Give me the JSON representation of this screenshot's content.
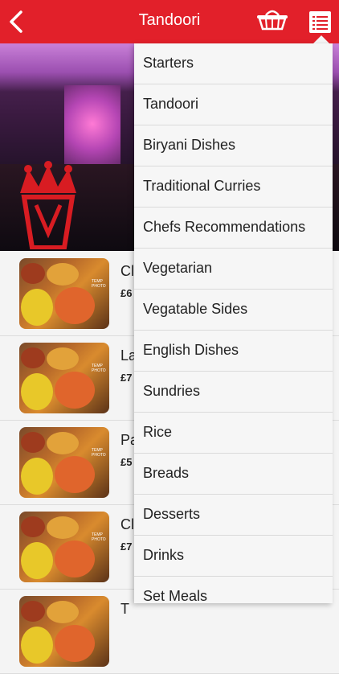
{
  "header": {
    "title": "Tandoori",
    "back_icon": "chevron-left-icon",
    "basket_icon": "basket-icon",
    "menu_icon": "list-menu-icon"
  },
  "colors": {
    "accent": "#e2202a"
  },
  "list": {
    "items": [
      {
        "name": "Cl",
        "price": "£6",
        "thumb_tag": "TEMP PHOTO"
      },
      {
        "name": "La",
        "price": "£7",
        "thumb_tag": "TEMP PHOTO"
      },
      {
        "name": "Pa",
        "price": "£5",
        "thumb_tag": "TEMP PHOTO"
      },
      {
        "name": "Cl",
        "price": "£7",
        "thumb_tag": "TEMP PHOTO"
      },
      {
        "name": "T",
        "price": "",
        "thumb_tag": ""
      }
    ]
  },
  "dropdown": {
    "items": [
      "Starters",
      "Tandoori",
      "Biryani Dishes",
      "Traditional Curries",
      "Chefs Recommendations",
      "Vegetarian",
      "Vegatable Sides",
      "English Dishes",
      "Sundries",
      "Rice",
      "Breads",
      "Desserts",
      "Drinks",
      "Set Meals"
    ]
  }
}
